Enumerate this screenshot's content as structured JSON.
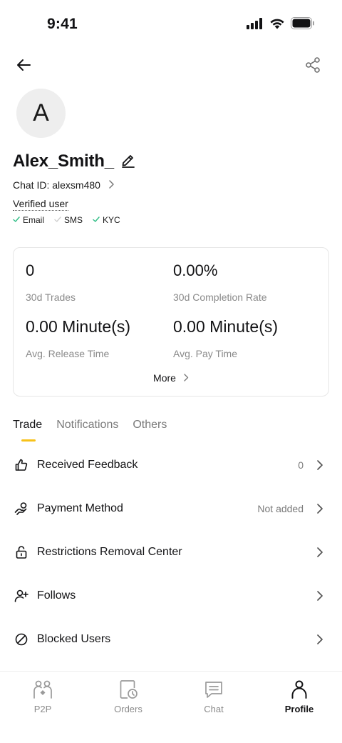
{
  "status_bar": {
    "time": "9:41"
  },
  "profile": {
    "avatar_letter": "A",
    "username": "Alex_Smith_",
    "chat_id_label": "Chat ID: alexsm480",
    "verified_label": "Verified user",
    "badges": [
      {
        "label": "Email",
        "verified": true
      },
      {
        "label": "SMS",
        "verified": false
      },
      {
        "label": "KYC",
        "verified": true
      }
    ]
  },
  "stats": {
    "trades_value": "0",
    "trades_label": "30d Trades",
    "completion_value": "0.00%",
    "completion_label": "30d Completion Rate",
    "release_value": "0.00 Minute(s)",
    "release_label": "Avg. Release Time",
    "pay_value": "0.00 Minute(s)",
    "pay_label": "Avg. Pay Time",
    "more_label": "More"
  },
  "tabs": [
    {
      "label": "Trade",
      "active": true
    },
    {
      "label": "Notifications",
      "active": false
    },
    {
      "label": "Others",
      "active": false
    }
  ],
  "menu": [
    {
      "label": "Received Feedback",
      "value": "0",
      "icon": "thumbs-up-icon"
    },
    {
      "label": "Payment Method",
      "value": "Not added",
      "icon": "payment-hand-icon"
    },
    {
      "label": "Restrictions Removal Center",
      "value": "",
      "icon": "unlock-icon"
    },
    {
      "label": "Follows",
      "value": "",
      "icon": "user-plus-icon"
    },
    {
      "label": "Blocked Users",
      "value": "",
      "icon": "block-icon"
    }
  ],
  "bottom_nav": [
    {
      "label": "P2P",
      "icon": "p2p-users-icon",
      "active": false
    },
    {
      "label": "Orders",
      "icon": "orders-clock-icon",
      "active": false
    },
    {
      "label": "Chat",
      "icon": "chat-bubble-icon",
      "active": false
    },
    {
      "label": "Profile",
      "icon": "profile-person-icon",
      "active": true
    }
  ],
  "colors": {
    "accent": "#f7c21a",
    "check_green": "#2ebd85",
    "text_primary": "#121214",
    "text_secondary": "#8a8a8a"
  }
}
